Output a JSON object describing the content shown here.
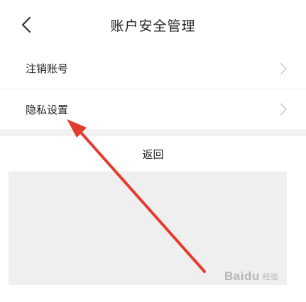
{
  "header": {
    "title": "账户安全管理",
    "back_icon": "chevron-left-icon"
  },
  "list": [
    {
      "label": "注销账号",
      "icon": "chevron-right-icon"
    },
    {
      "label": "隐私设置",
      "icon": "chevron-right-icon"
    }
  ],
  "footer": {
    "return_label": "返回"
  },
  "annotation": {
    "color": "#e53b2f"
  },
  "watermark": {
    "text": "Baidu",
    "sub": "经验"
  }
}
